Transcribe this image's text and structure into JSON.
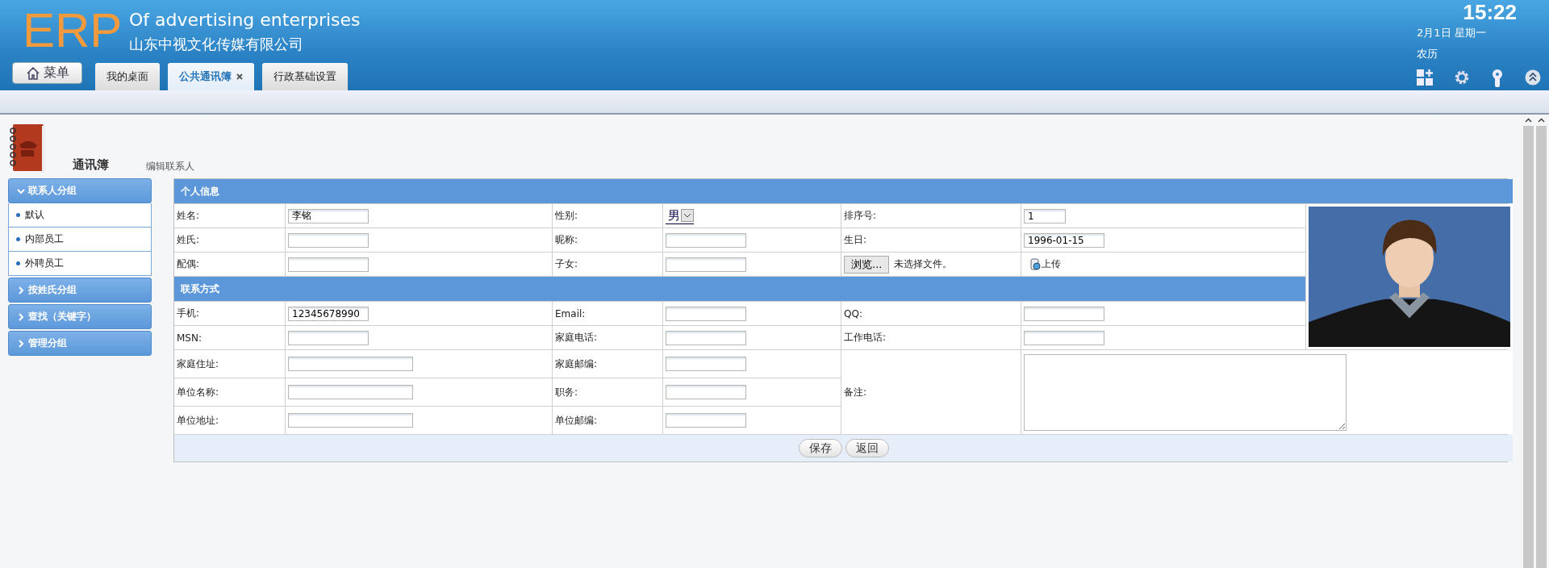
{
  "header": {
    "logo": "ERP",
    "title": "Of advertising enterprises",
    "subtitle": "山东中视文化传媒有限公司",
    "menu_button": "菜单",
    "tabs": [
      {
        "label": "我的桌面",
        "selected": false,
        "closable": false
      },
      {
        "label": "公共通讯簿",
        "selected": true,
        "closable": true
      },
      {
        "label": "行政基础设置",
        "selected": false,
        "closable": false
      }
    ],
    "clock": {
      "time": "15:22",
      "date": "2月1日 星期一",
      "lunar": "农历"
    }
  },
  "page": {
    "title": "通讯簿",
    "subtitle": "编辑联系人"
  },
  "sidebar": {
    "groups": [
      {
        "label": "联系人分组",
        "expanded": true,
        "items": [
          "默认",
          "内部员工",
          "外聘员工"
        ]
      },
      {
        "label": "按姓氏分组",
        "expanded": false
      },
      {
        "label": "查找（关键字）",
        "expanded": false
      },
      {
        "label": "管理分组",
        "expanded": false
      }
    ]
  },
  "form": {
    "section_1": "个人信息",
    "section_2": "联系方式",
    "personal_rows": [
      [
        {
          "label": "姓名:",
          "kind": "text",
          "value": "李铭"
        },
        {
          "label": "性别:",
          "kind": "select",
          "value": "男"
        },
        {
          "label": "排序号:",
          "kind": "short",
          "value": "1"
        }
      ],
      [
        {
          "label": "姓氏:",
          "kind": "text"
        },
        {
          "label": "昵称:",
          "kind": "text"
        },
        {
          "label": "生日:",
          "kind": "text",
          "value": "1996-01-15"
        }
      ],
      [
        {
          "label": "配偶:",
          "kind": "text"
        },
        {
          "label": "子女:",
          "kind": "text"
        },
        {
          "kind": "file",
          "button": "浏览...",
          "status": "未选择文件。",
          "upload": "上传"
        }
      ]
    ],
    "contact_rows": [
      [
        {
          "label": "手机:",
          "kind": "text",
          "value": "12345678990"
        },
        {
          "label": "Email:",
          "kind": "text"
        },
        {
          "label": "QQ:",
          "kind": "text"
        }
      ],
      [
        {
          "label": "MSN:",
          "kind": "text"
        },
        {
          "label": "家庭电话:",
          "kind": "text"
        },
        {
          "label": "工作电话:",
          "kind": "text"
        }
      ]
    ],
    "address_rows": [
      [
        {
          "label": "家庭住址:",
          "kind": "wide"
        },
        {
          "label": "家庭邮编:",
          "kind": "text"
        }
      ],
      [
        {
          "label": "单位名称:",
          "kind": "wide"
        },
        {
          "label": "职务:",
          "kind": "text"
        }
      ],
      [
        {
          "label": "单位地址:",
          "kind": "wide"
        },
        {
          "label": "单位邮编:",
          "kind": "text"
        }
      ]
    ],
    "remark_label": "备注:",
    "photo": {
      "kind": "picture"
    },
    "buttons": [
      "保存",
      "返回"
    ]
  }
}
